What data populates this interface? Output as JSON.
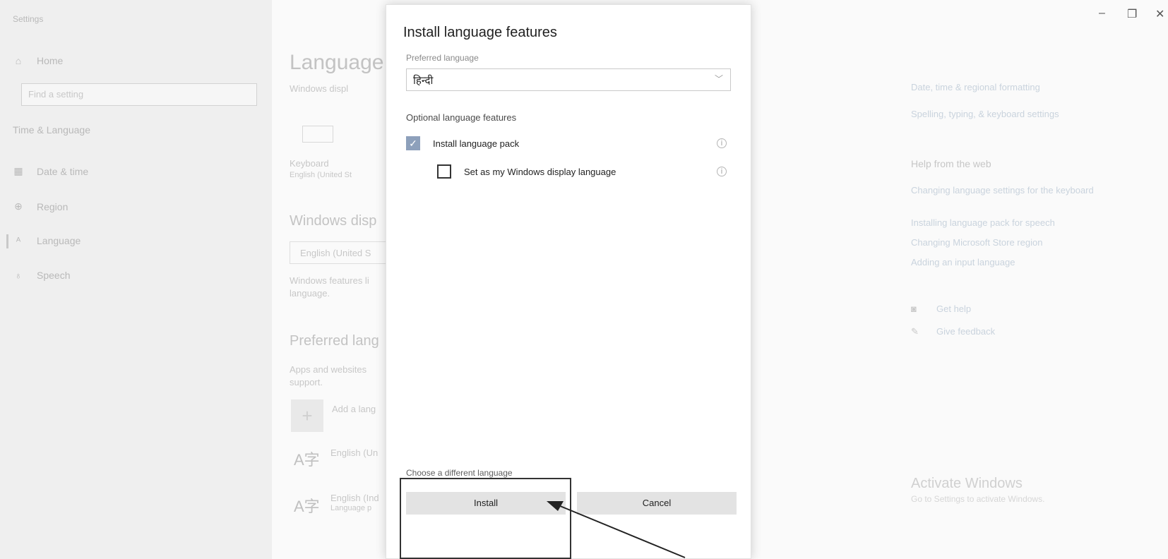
{
  "window": {
    "app_title": "Settings",
    "minimize_glyph": "–",
    "restore_glyph": "❐",
    "close_glyph": "✕"
  },
  "sidebar": {
    "home_label": "Home",
    "search_placeholder": "Find a setting",
    "section_title": "Time & Language",
    "items": [
      {
        "label": "Date & time",
        "icon": "calendar-icon"
      },
      {
        "label": "Region",
        "icon": "globe-icon"
      },
      {
        "label": "Language",
        "icon": "language-icon",
        "active": true
      },
      {
        "label": "Speech",
        "icon": "microphone-icon"
      }
    ]
  },
  "main": {
    "title": "Language",
    "windows_display_lang_text": "Windows displ",
    "keyboard_label": "Keyboard",
    "keyboard_sub": "English (United St",
    "windows_display_heading": "Windows disp",
    "display_value": "English (United S",
    "features_text_1": "Windows features li",
    "features_text_2": "language.",
    "preferred_heading": "Preferred lang",
    "apps_text_1": "Apps and websites",
    "apps_text_2": "support.",
    "add_language": "Add a lang",
    "lang_item_1": "English (Un",
    "lang_item_2": "English (Ind",
    "lang_item_2_sub": "Language p"
  },
  "right_panel": {
    "link_1": "Date, time & regional formatting",
    "link_2": "Spelling, typing, & keyboard settings",
    "help_heading": "Help from the web",
    "help_links": [
      "Changing language settings for the keyboard",
      "Installing language pack for speech",
      "Changing Microsoft Store region",
      "Adding an input language"
    ],
    "get_help": "Get help",
    "give_feedback": "Give feedback",
    "activate_title": "Activate Windows",
    "activate_sub": "Go to Settings to activate Windows."
  },
  "dialog": {
    "title": "Install language features",
    "preferred_label": "Preferred language",
    "selected_language": "हिन्दी",
    "optional_heading": "Optional language features",
    "option_pack": {
      "label": "Install language pack",
      "checked": true
    },
    "option_display": {
      "label": "Set as my Windows display language",
      "checked": false
    },
    "choose_different": "Choose a different language",
    "install_label": "Install",
    "cancel_label": "Cancel"
  }
}
